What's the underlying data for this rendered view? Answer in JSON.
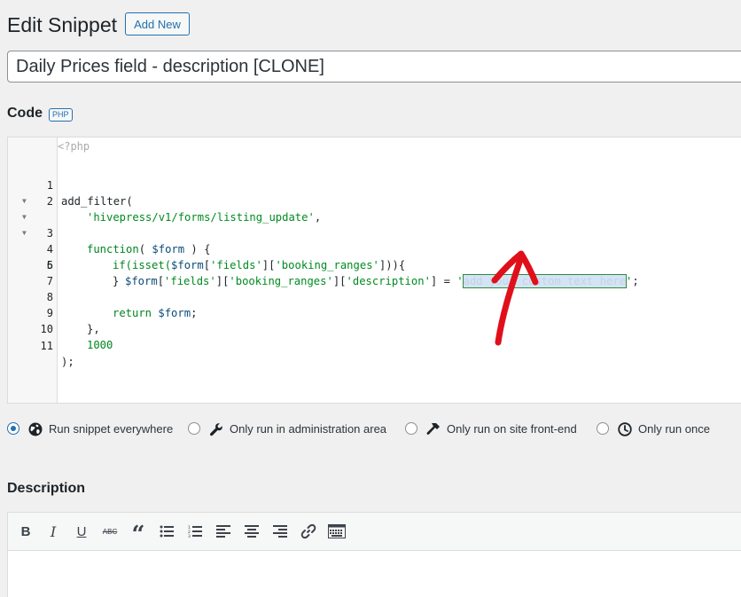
{
  "header": {
    "title": "Edit Snippet",
    "add_new_label": "Add New"
  },
  "snippet": {
    "name": "Daily Prices field - description [CLONE]"
  },
  "code_section": {
    "heading": "Code",
    "language_badge": "PHP",
    "php_open_tag": "<?php",
    "line_numbers": [
      "1",
      "2",
      "3",
      "4",
      "5",
      "6",
      "7",
      "8",
      "9",
      "10",
      "11"
    ],
    "lines": {
      "l1": "add_filter(",
      "l2_str": "'hivepress/v1/forms/listing_update'",
      "l2_end": ",",
      "l3_kw": "function",
      "l3_a": "( ",
      "l3_var": "$form",
      "l3_b": " ) {",
      "l4_a": "if(isset(",
      "l4_var": "$form",
      "l4_b": "[",
      "l4_s1": "'fields'",
      "l4_c": "][",
      "l4_s2": "'booking_ranges'",
      "l4_d": "])){",
      "l5_var": "$form",
      "l5_a": "[",
      "l5_s1": "'fields'",
      "l5_b": "][",
      "l5_s2": "'booking_ranges'",
      "l5_c": "][",
      "l5_s3": "'description'",
      "l5_d": "] = ",
      "l5_q1": "'",
      "l5_sel": "add your custom text here",
      "l5_q2": "'",
      "l5_e": ";",
      "l6": "}",
      "l8_kw": "return ",
      "l8_var": "$form",
      "l8_end": ";",
      "l9": "},",
      "l10": "1000",
      "l11": ");"
    }
  },
  "run_options": [
    {
      "label": "Run snippet everywhere",
      "icon": "globe-icon",
      "checked": true
    },
    {
      "label": "Only run in administration area",
      "icon": "wrench-icon",
      "checked": false
    },
    {
      "label": "Only run on site front-end",
      "icon": "hammer-icon",
      "checked": false
    },
    {
      "label": "Only run once",
      "icon": "clock-icon",
      "checked": false
    }
  ],
  "description_section": {
    "heading": "Description",
    "toolbar": [
      "bold-icon",
      "italic-icon",
      "underline-icon",
      "strikethrough-icon",
      "blockquote-icon",
      "bullet-list-icon",
      "numbered-list-icon",
      "align-left-icon",
      "align-center-icon",
      "align-right-icon",
      "link-icon",
      "toolbar-toggle-icon"
    ],
    "toolbar_glyphs": {
      "bold": "B",
      "italic": "I",
      "underline": "U",
      "strike": "ABC",
      "quote": "“"
    }
  },
  "colors": {
    "accent": "#2271b1",
    "annotation_red": "#e0101a",
    "string_green": "#008a20",
    "variable_blue": "#0a4b78"
  }
}
